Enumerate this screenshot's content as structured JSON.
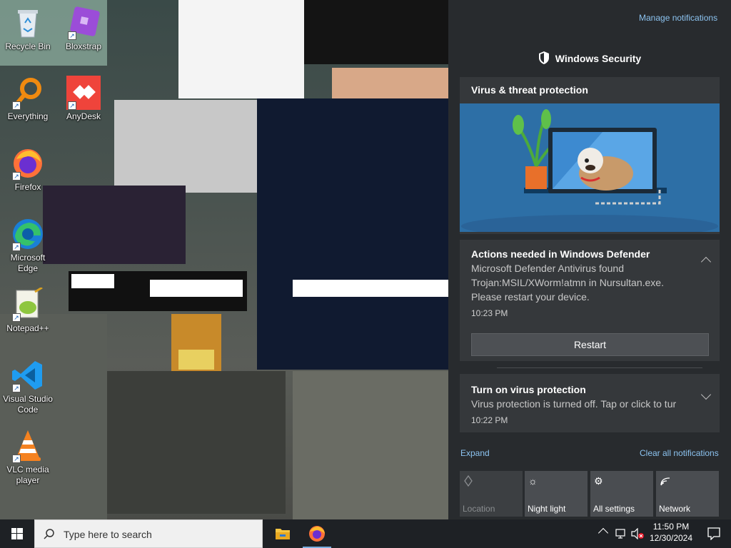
{
  "desktop": {
    "icons": [
      {
        "label": "Recycle Bin",
        "icon": "recycle-bin-icon"
      },
      {
        "label": "Bloxstrap",
        "icon": "bloxstrap-icon"
      },
      {
        "label": "Everything",
        "icon": "everything-search-icon"
      },
      {
        "label": "AnyDesk",
        "icon": "anydesk-icon"
      },
      {
        "label": "Firefox",
        "icon": "firefox-icon"
      },
      {
        "label": "Microsoft Edge",
        "icon": "edge-icon"
      },
      {
        "label": "Notepad++",
        "icon": "notepad-plus-plus-icon"
      },
      {
        "label": "Visual Studio Code",
        "icon": "vscode-icon"
      },
      {
        "label": "VLC media player",
        "icon": "vlc-icon"
      }
    ]
  },
  "action_center": {
    "manage_link": "Manage notifications",
    "app_title": "Windows Security",
    "card_title": "Virus & threat protection",
    "notifications": [
      {
        "title": "Actions needed in Windows Defender",
        "body": "Microsoft Defender Antivirus found Trojan:MSIL/XWorm!atmn in Nursultan.exe. Please restart your device.",
        "time": "10:23 PM",
        "button": "Restart"
      },
      {
        "title": "Turn on virus protection",
        "body": "Virus protection is turned off. Tap or click to tur",
        "time": "10:22 PM"
      }
    ],
    "expand_label": "Expand",
    "clear_label": "Clear all notifications",
    "quick_actions": [
      {
        "label": "Location",
        "icon": "location-icon",
        "state": "off"
      },
      {
        "label": "Night light",
        "icon": "night-light-icon",
        "state": "on"
      },
      {
        "label": "All settings",
        "icon": "settings-gear-icon",
        "state": "on"
      },
      {
        "label": "Network",
        "icon": "network-icon",
        "state": "on"
      }
    ],
    "colors": {
      "background": "#282b2e",
      "card": "#35383b",
      "link": "#8cc3f0",
      "illustration_bg": "#2d6fa6"
    }
  },
  "taskbar": {
    "search_placeholder": "Type here to search",
    "pinned": [
      {
        "name": "File Explorer",
        "icon": "file-explorer-icon"
      },
      {
        "name": "Firefox",
        "icon": "firefox-icon"
      }
    ],
    "clock": {
      "time": "11:50 PM",
      "date": "12/30/2024"
    }
  }
}
